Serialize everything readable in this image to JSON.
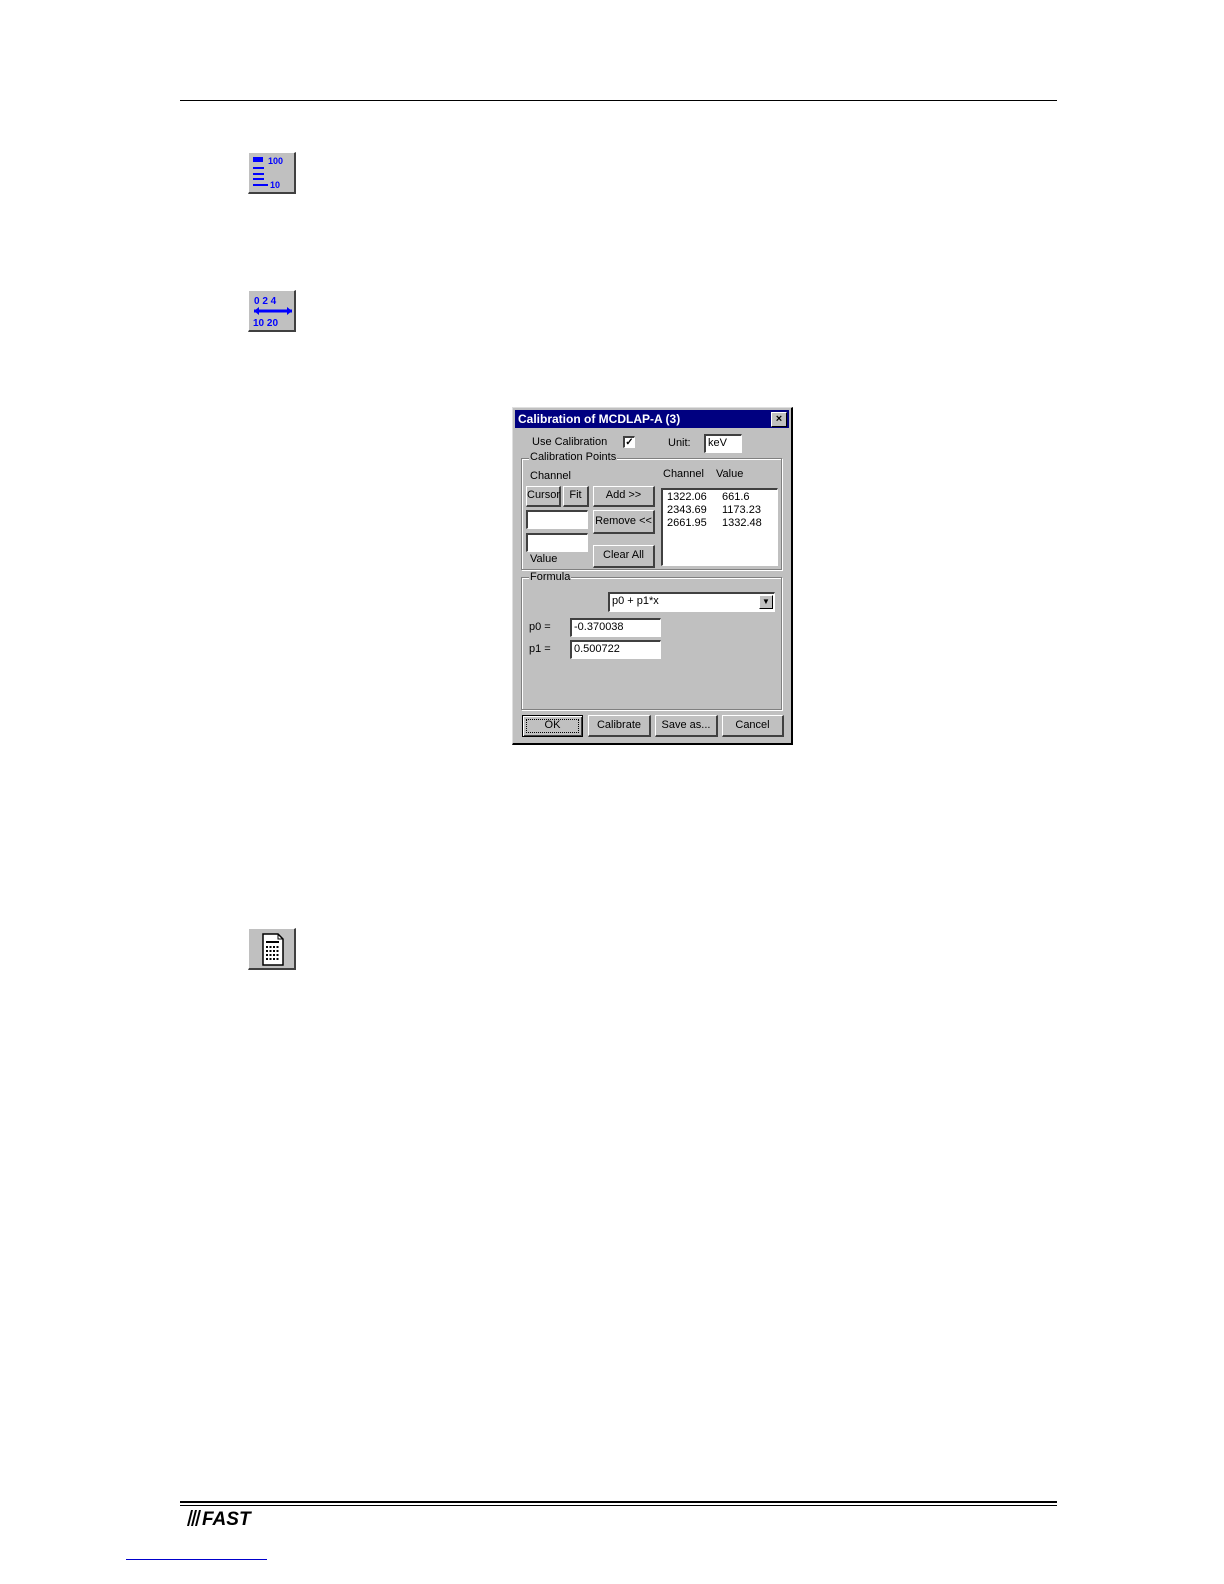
{
  "page": {
    "logo_text": "FAST"
  },
  "icons": [
    "log-scale-icon",
    "axis-calibration-icon",
    "document-list-icon"
  ],
  "dialog": {
    "title": "Calibration of MCDLAP-A (3)",
    "close_glyph": "×",
    "use_calibration_label": "Use Calibration",
    "use_calibration_checked": true,
    "unit_label": "Unit:",
    "unit_value": "keV",
    "calibration_points_label": "Calibration Points",
    "channel_label": "Channel",
    "value_label": "Value",
    "cursor_button": "Cursor",
    "fit_button": "Fit",
    "add_button": "Add >>",
    "remove_button": "Remove <<",
    "clear_all_button": "Clear All",
    "channel_input": "",
    "value_input": "",
    "list_headers": [
      "Channel",
      "Value"
    ],
    "points": [
      {
        "channel": "1322.06",
        "value": "661.6"
      },
      {
        "channel": "2343.69",
        "value": "1173.23"
      },
      {
        "channel": "2661.95",
        "value": "1332.48"
      }
    ],
    "formula_label": "Formula",
    "formula_selected": "p0 + p1*x",
    "p0_label": "p0 =",
    "p0_value": "-0.370038",
    "p1_label": "p1 =",
    "p1_value": "0.500722",
    "ok_button": "OK",
    "calibrate_button": "Calibrate",
    "save_as_button": "Save as...",
    "cancel_button": "Cancel"
  }
}
